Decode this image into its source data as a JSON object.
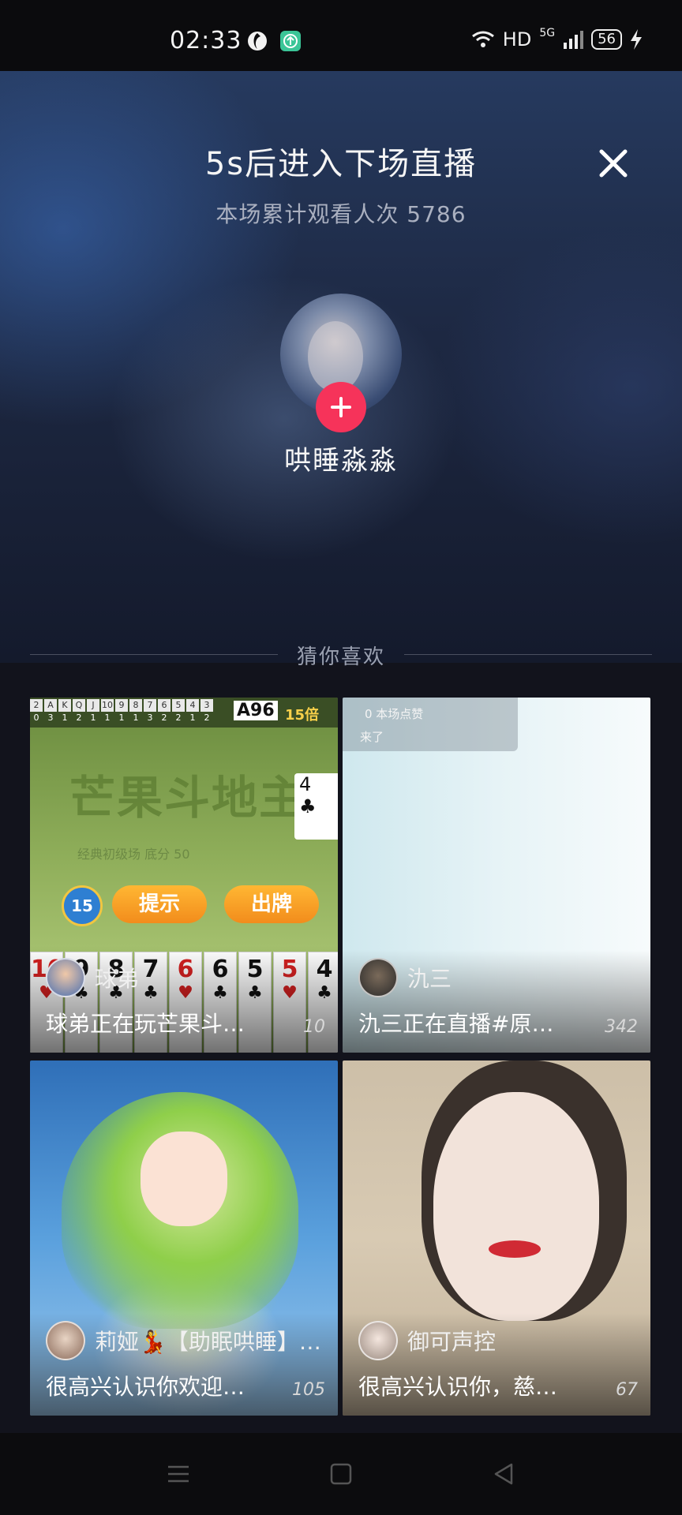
{
  "status_bar": {
    "time": "02:33",
    "network": "HD",
    "signal": "5G",
    "battery": "56"
  },
  "header": {
    "title": "5s后进入下场直播",
    "subtitle": "本场累计观看人次 5786"
  },
  "streamer": {
    "name": "哄睡淼淼"
  },
  "recommend": {
    "section_title": "猜你喜欢",
    "cards": [
      {
        "host": "球弟",
        "desc": "球弟正在玩芒果斗…",
        "count": "10",
        "theme": "card-game"
      },
      {
        "host": "氿三",
        "desc": "氿三正在直播#原…",
        "count": "342",
        "theme": "light"
      },
      {
        "host": "莉娅💃【助眠哄睡】…",
        "desc": "很高兴认识你欢迎…",
        "count": "105",
        "theme": "anime"
      },
      {
        "host": "御可声控",
        "desc": "很高兴认识你，慈…",
        "count": "67",
        "theme": "portrait"
      }
    ]
  },
  "card_game": {
    "top_cells": [
      "2",
      "A",
      "K",
      "Q",
      "J",
      "10",
      "9",
      "8",
      "7",
      "6",
      "5",
      "4",
      "3"
    ],
    "top_counts": [
      "0",
      "3",
      "1",
      "2",
      "1",
      "1",
      "1",
      "1",
      "3",
      "2",
      "2",
      "1",
      "2"
    ],
    "multiplier": "15倍",
    "logo": "芒果斗地主",
    "logo_sub": "经典初级场 底分 50",
    "timer": "15",
    "hint_button": "提示",
    "play_button": "出牌",
    "hand": [
      "10",
      "9",
      "8",
      "7",
      "6",
      "6",
      "5",
      "5",
      "4"
    ],
    "side_card": "4",
    "top_hand": "A96"
  },
  "live_chat": {
    "likes": "0 本场点赞",
    "joined": "来了"
  },
  "colors": {
    "accent": "#f6335a",
    "background": "#12131c"
  }
}
